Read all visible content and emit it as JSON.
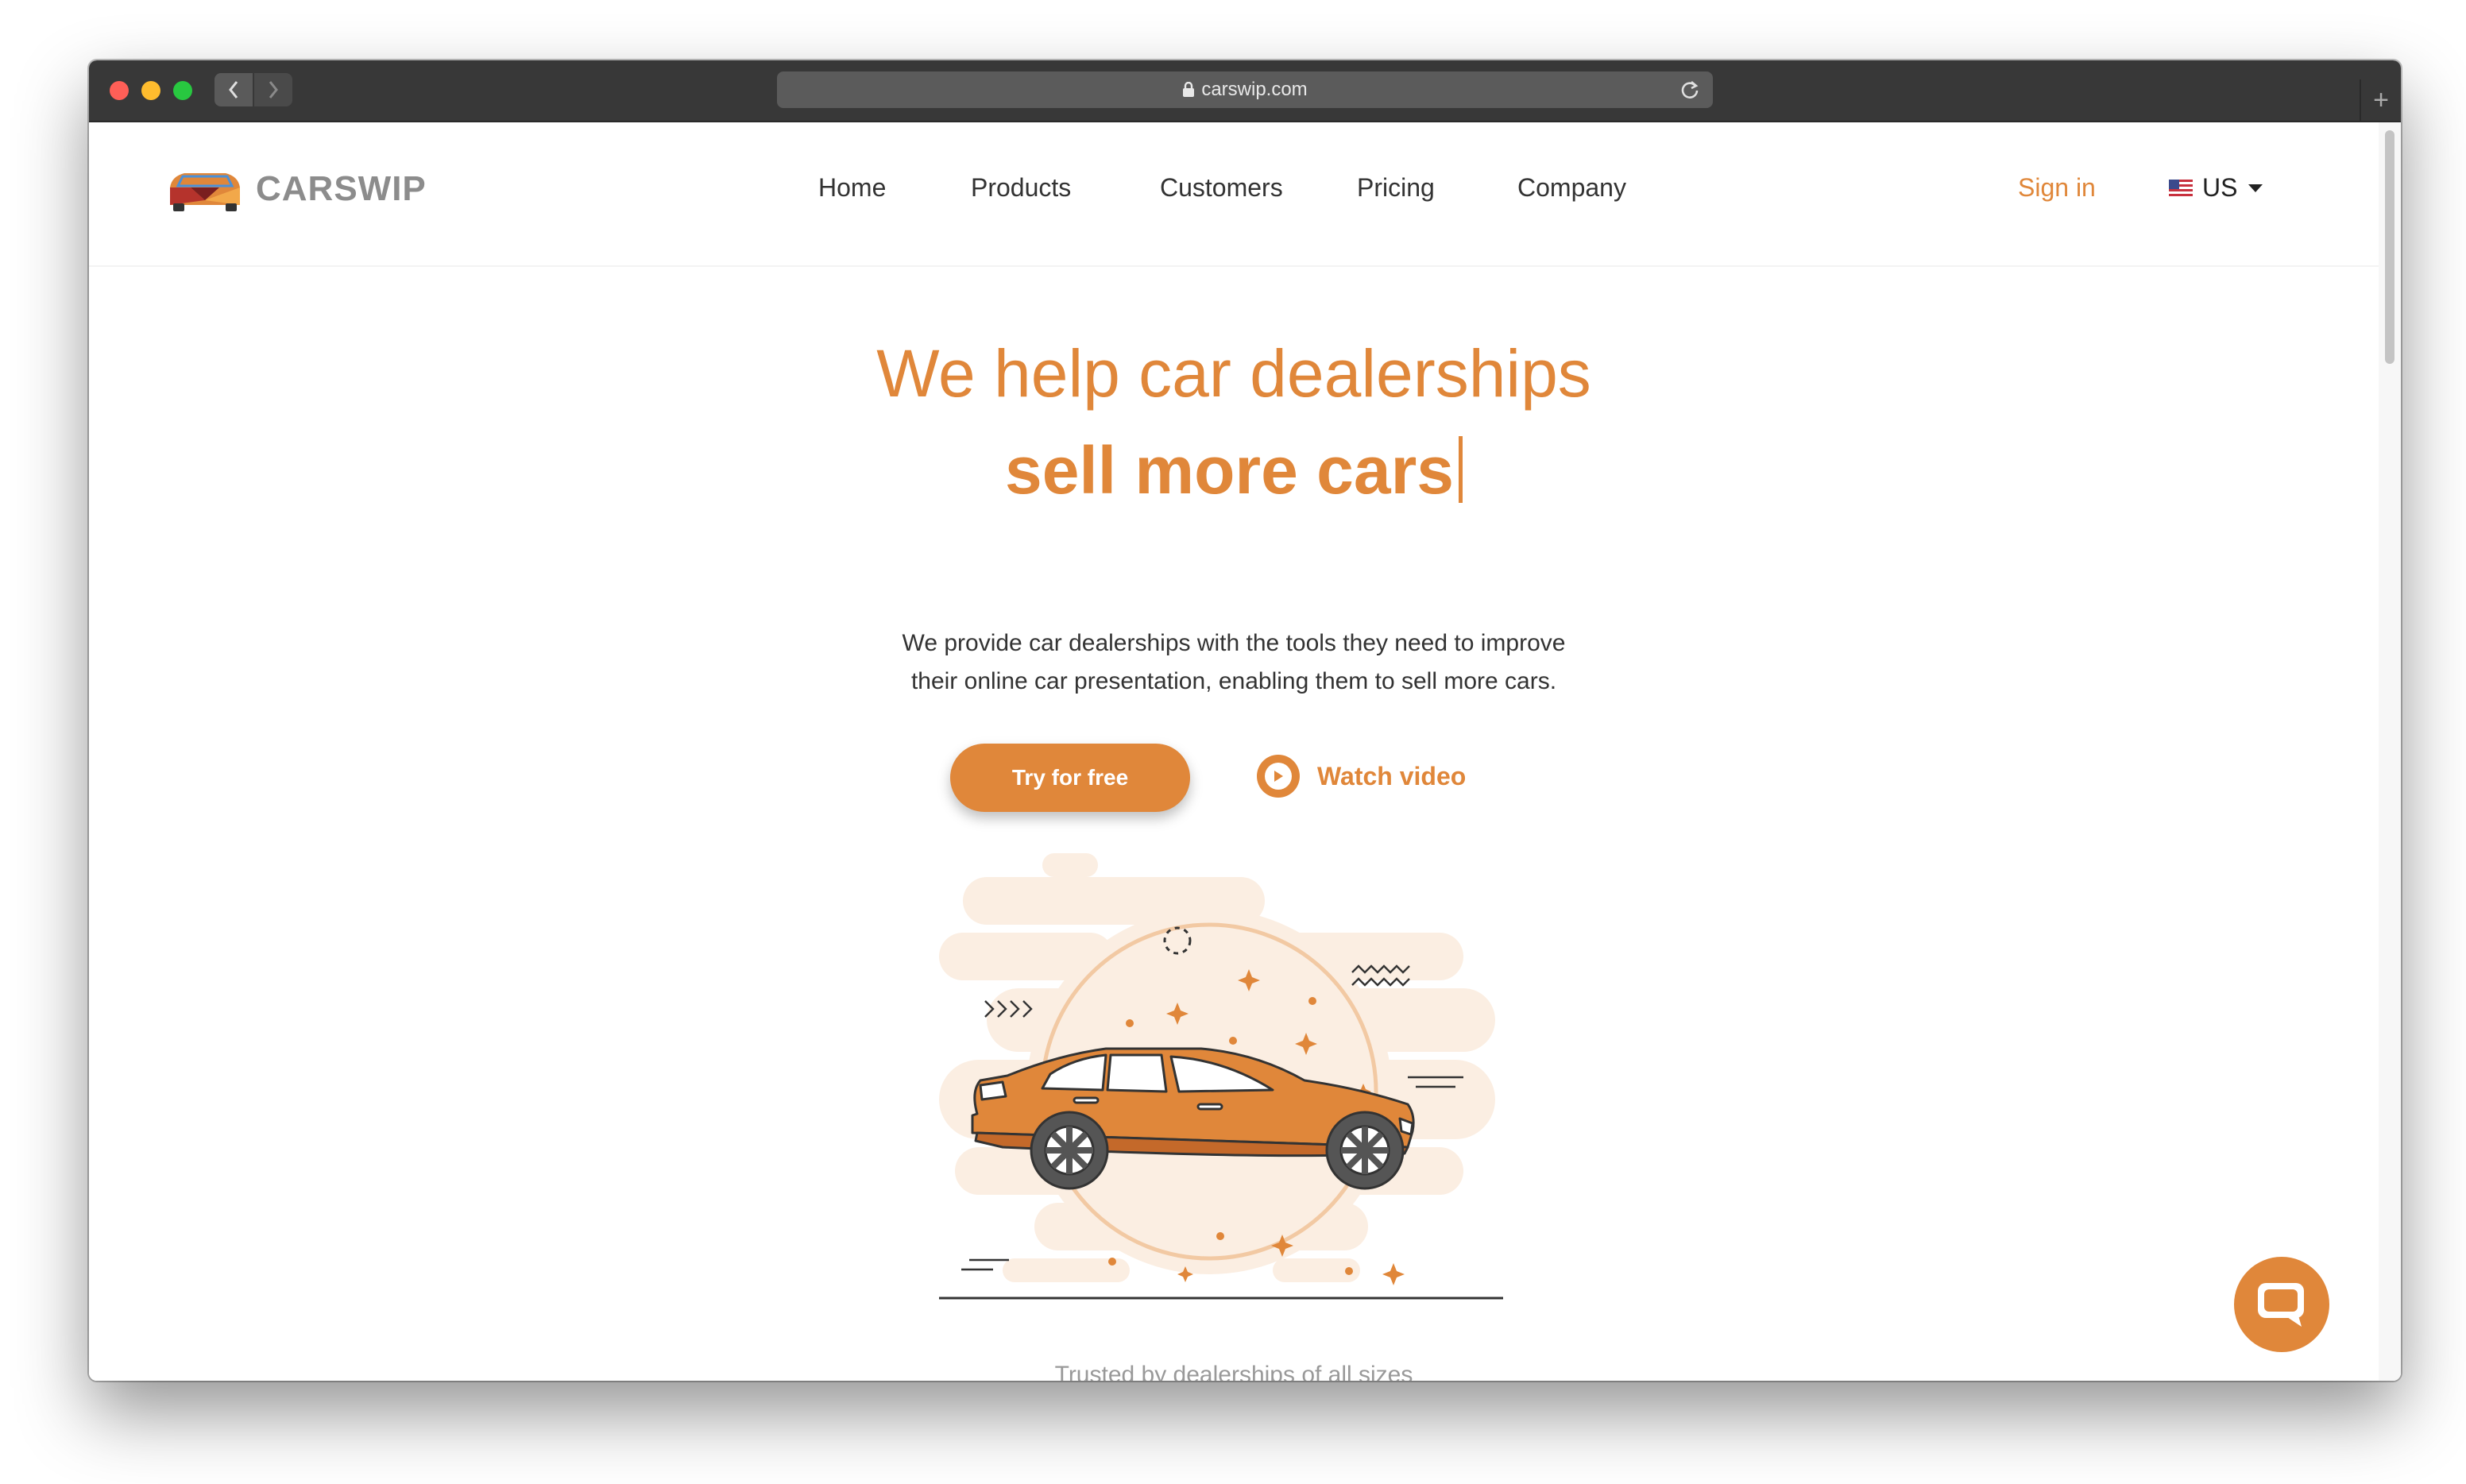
{
  "browser": {
    "url": "carswip.com",
    "icons": {
      "back": "chevron-left-icon",
      "forward": "chevron-right-icon",
      "lock": "lock-icon",
      "reload": "reload-icon",
      "new_tab": "plus-icon"
    }
  },
  "header": {
    "logo_text": "CARSWIP",
    "nav": [
      "Home",
      "Products",
      "Customers",
      "Pricing",
      "Company"
    ],
    "sign_in": "Sign in",
    "language": "US"
  },
  "hero": {
    "title_line1": "We help car dealerships",
    "title_line2": "sell more cars",
    "description_line1": "We provide car dealerships with the tools they need to improve",
    "description_line2": "their online car presentation, enabling them to sell more cars.",
    "primary_button": "Try for free",
    "secondary_button": "Watch video"
  },
  "footer_teaser": "Trusted by dealerships of all sizes",
  "colors": {
    "accent": "#e0873a",
    "text": "#333333",
    "logo_gray": "#8c8c8c"
  }
}
